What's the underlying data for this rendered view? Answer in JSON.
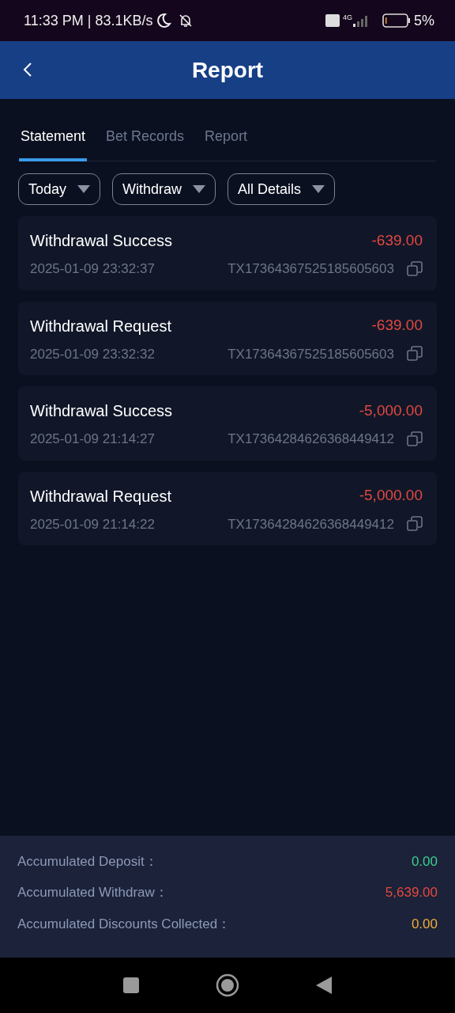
{
  "status_bar": {
    "time": "11:33 PM | 83.1KB/s",
    "network": "4G",
    "battery": "5%"
  },
  "header": {
    "title": "Report"
  },
  "tabs": [
    {
      "label": "Statement",
      "selected": true
    },
    {
      "label": "Bet Records",
      "selected": false
    },
    {
      "label": "Report",
      "selected": false
    }
  ],
  "filters": [
    {
      "label": "Today"
    },
    {
      "label": "Withdraw"
    },
    {
      "label": "All Details"
    }
  ],
  "transactions": [
    {
      "title": "Withdrawal Success",
      "amount": "-639.00",
      "time": "2025-01-09 23:32:37",
      "id": "TX17364367525185605603"
    },
    {
      "title": "Withdrawal Request",
      "amount": "-639.00",
      "time": "2025-01-09 23:32:32",
      "id": "TX17364367525185605603"
    },
    {
      "title": "Withdrawal Success",
      "amount": "-5,000.00",
      "time": "2025-01-09 21:14:27",
      "id": "TX17364284626368449412"
    },
    {
      "title": "Withdrawal Request",
      "amount": "-5,000.00",
      "time": "2025-01-09 21:14:22",
      "id": "TX17364284626368449412"
    }
  ],
  "totals": [
    {
      "label": "Accumulated Deposit：",
      "value": "0.00",
      "color": "#3ecf8e"
    },
    {
      "label": "Accumulated Withdraw：",
      "value": "5,639.00",
      "color": "#e5483f"
    },
    {
      "label": "Accumulated Discounts Collected：",
      "value": "0.00",
      "color": "#f0ad3c"
    }
  ]
}
